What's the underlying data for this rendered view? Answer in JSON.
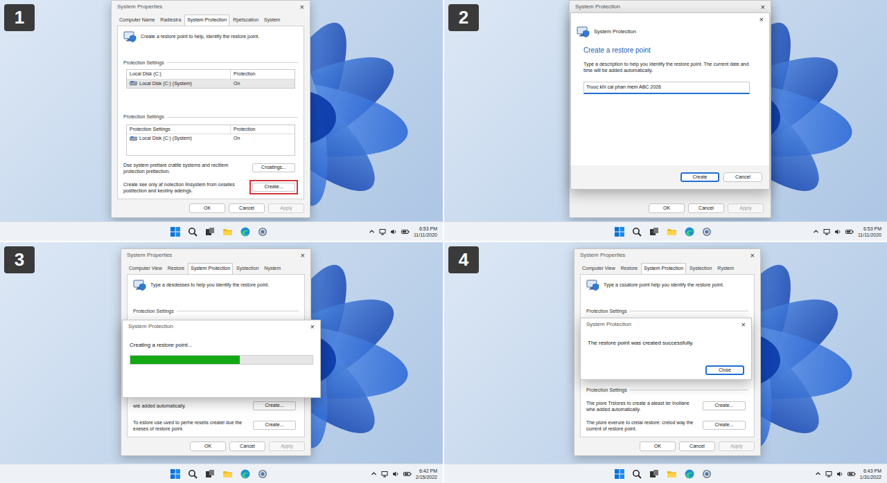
{
  "panels": [
    {
      "kind": "properties",
      "badge": "1",
      "clock": {
        "time": "6:53 PM",
        "date": "11/11/2020"
      },
      "window": {
        "title": "System Properties",
        "close": "×",
        "tabs": [
          {
            "label": "Computer Name",
            "selected": false
          },
          {
            "label": "Radiestra",
            "selected": false
          },
          {
            "label": "System Protection",
            "selected": true
          },
          {
            "label": "Rpetscation",
            "selected": false
          },
          {
            "label": "System",
            "selected": false
          }
        ],
        "intro": "Create a restore point to help, identify the restore point.",
        "groups": [
          {
            "label": "Protection Settings",
            "table": {
              "columns": [
                "Local Disk (C:)",
                "Protection"
              ],
              "rows": [
                {
                  "cells": [
                    "Local Disk (C:) (System)",
                    "On"
                  ],
                  "selected": true
                }
              ]
            }
          },
          {
            "label": "Protection Settings",
            "table": {
              "columns": [
                "Protection Settings",
                "Protection"
              ],
              "rows": [
                {
                  "cells": [
                    "Local Disk (C:) (System)",
                    "On"
                  ],
                  "selected": false
                }
              ]
            },
            "actions": [
              {
                "text": "Dse system prettare crattle systems and recitlem protection prettection.",
                "button": "Croatings...",
                "highlighted": false
              },
              {
                "text": "Create see only af notection Ilnsystem from oxsetes posttection and keotiny adeings.",
                "button": "Create...",
                "highlighted": true
              }
            ]
          }
        ],
        "buttons": [
          {
            "label": "OK",
            "disabled": false,
            "primary": false
          },
          {
            "label": "Cancel",
            "disabled": false,
            "primary": false
          },
          {
            "label": "Apply",
            "disabled": true,
            "primary": false
          }
        ]
      }
    },
    {
      "kind": "create",
      "badge": "2",
      "clock": {
        "time": "6:53 PM",
        "date": "11/11/2020"
      },
      "window": {
        "title": "System Protection",
        "close": "×",
        "buttons": [
          {
            "label": "OK",
            "disabled": false,
            "primary": false
          },
          {
            "label": "Cancel",
            "disabled": false,
            "primary": false
          },
          {
            "label": "Apply",
            "disabled": true,
            "primary": false
          }
        ]
      },
      "dialog": {
        "title": "System Protection",
        "close": "×",
        "heading": "Create a restore point",
        "text": "Type a description to help you identify the restore point. The current date and time will be added automatically.",
        "input": "Truoc khi cai phan mem ABC 2026",
        "buttons": [
          {
            "label": "Create",
            "disabled": false,
            "primary": true
          },
          {
            "label": "Cancel",
            "disabled": false,
            "primary": false
          }
        ]
      }
    },
    {
      "kind": "progress",
      "badge": "3",
      "clock": {
        "time": "6:42 PM",
        "date": "2/15/2022"
      },
      "window": {
        "title": "System Properties",
        "close": "×",
        "tabs": [
          {
            "label": "Computer View",
            "selected": false
          },
          {
            "label": "Restore",
            "selected": false
          },
          {
            "label": "System Protection",
            "selected": true
          },
          {
            "label": "Systection",
            "selected": false
          },
          {
            "label": "Nystem",
            "selected": false
          }
        ],
        "intro": "Type a desdesses to help you identify the restore point.",
        "groups": [
          {
            "label": "Protection Settings"
          },
          {
            "actions": [
              {
                "text": "wie added automatically.",
                "button": "Create...",
                "highlighted": false
              },
              {
                "text": "To estore use uved to perhe reselis createl due the exeses of restore point.",
                "button": "Create...",
                "highlighted": false
              }
            ]
          }
        ],
        "buttons": [
          {
            "label": "OK",
            "disabled": false,
            "primary": false
          },
          {
            "label": "Cancel",
            "disabled": false,
            "primary": false
          },
          {
            "label": "Apply",
            "disabled": true,
            "primary": false
          }
        ]
      },
      "dialog": {
        "title": "System Protection",
        "close": "×",
        "text": "Creating a restore point...",
        "level": 0.6
      }
    },
    {
      "kind": "success",
      "badge": "4",
      "clock": {
        "time": "6:43 PM",
        "date": "1/31/2022"
      },
      "window": {
        "title": "System Properties",
        "close": "×",
        "tabs": [
          {
            "label": "Computer View",
            "selected": false
          },
          {
            "label": "Restore",
            "selected": false
          },
          {
            "label": "System Protection",
            "selected": true
          },
          {
            "label": "Systection",
            "selected": false
          },
          {
            "label": "Rystem",
            "selected": false
          }
        ],
        "intro": "Type a cssatore point help you identify the restore point.",
        "groups": [
          {
            "label": "Protection Settings"
          },
          {
            "label": "Protection Settings",
            "actions": [
              {
                "text": "The piore Trstores to create a aleast ier Inollane whe added automatically.",
                "button": "Create...",
                "highlighted": false
              },
              {
                "text": "The plore everure to crelai restore: crelod way the current of restore point.",
                "button": "Create...",
                "highlighted": false
              }
            ]
          }
        ],
        "buttons": [
          {
            "label": "OK",
            "disabled": false,
            "primary": false
          },
          {
            "label": "Cancel",
            "disabled": false,
            "primary": false
          },
          {
            "label": "Apply",
            "disabled": true,
            "primary": false
          }
        ]
      },
      "dialog": {
        "title": "System Protection",
        "close": "×",
        "text": "The restore point was created successfully.",
        "buttons": [
          {
            "label": "Close",
            "disabled": false,
            "primary": true
          }
        ]
      }
    }
  ]
}
